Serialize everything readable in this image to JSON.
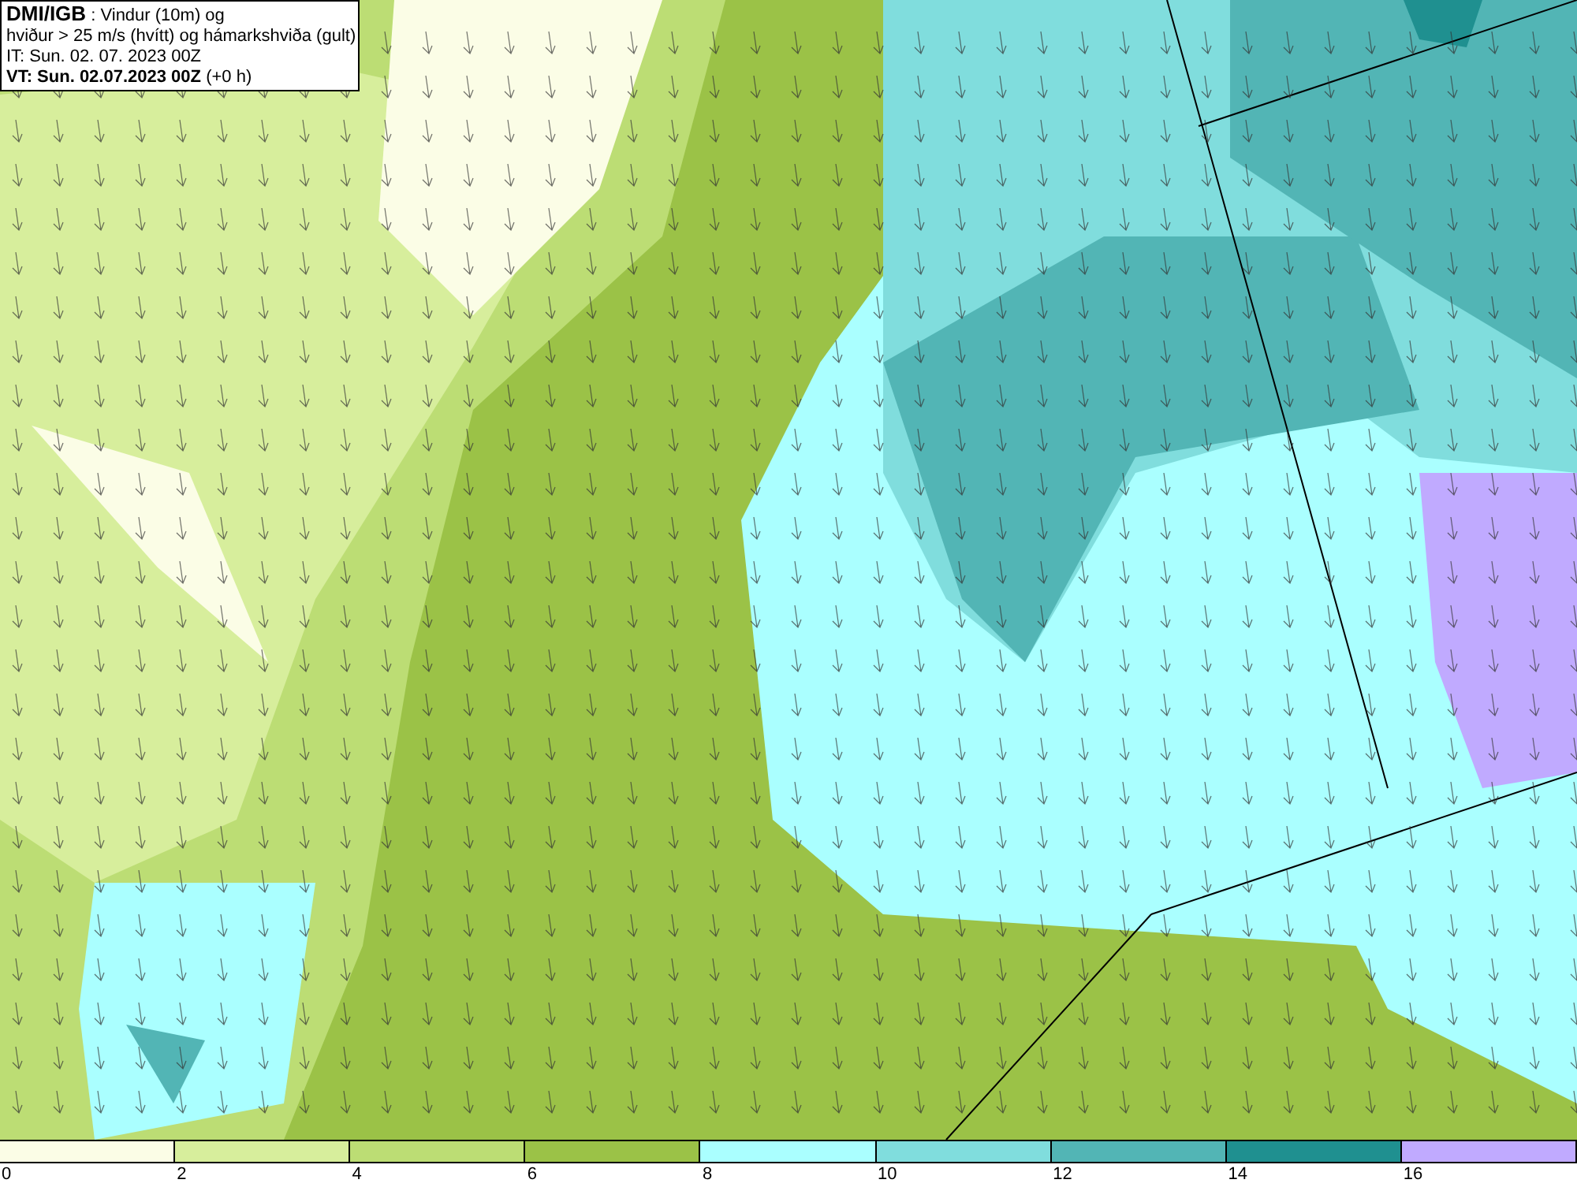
{
  "title_box": {
    "source": "DMI/IGB",
    "description": " : Vindur (10m) og",
    "line_2": "hviður > 25 m/s (hvítt) og hámarkshviða (gult)",
    "initial_time": "IT: Sun. 02. 07. 2023 00Z",
    "valid_time": "VT: Sun. 02.07.2023 00Z",
    "offset": "(+0 h)"
  },
  "legend": [
    {
      "label": "0",
      "color": "#fbfde6"
    },
    {
      "label": "2",
      "color": "#d7ee9c"
    },
    {
      "label": "4",
      "color": "#bcdd74"
    },
    {
      "label": "6",
      "color": "#9bc247"
    },
    {
      "label": "8",
      "color": "#aaffff"
    },
    {
      "label": "10",
      "color": "#80dddd"
    },
    {
      "label": "12",
      "color": "#52b5b5"
    },
    {
      "label": "14",
      "color": "#1f9090"
    },
    {
      "label": "16",
      "color": "#c0aaff"
    }
  ]
}
